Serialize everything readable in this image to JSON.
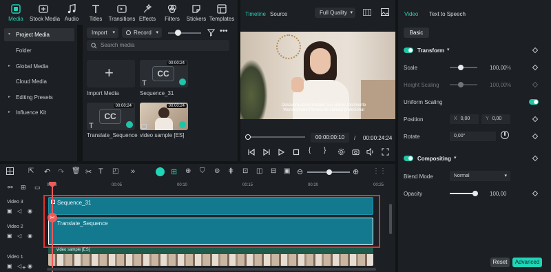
{
  "toolbar": {
    "tabs": [
      {
        "label": "Media",
        "icon": "media-icon",
        "active": true
      },
      {
        "label": "Stock Media",
        "icon": "stock-media-icon"
      },
      {
        "label": "Audio",
        "icon": "music-note-icon"
      },
      {
        "label": "Titles",
        "icon": "text-t-icon"
      },
      {
        "label": "Transitions",
        "icon": "transitions-icon"
      },
      {
        "label": "Effects",
        "icon": "effects-sparkle-icon"
      },
      {
        "label": "Filters",
        "icon": "filters-icon"
      },
      {
        "label": "Stickers",
        "icon": "stickers-icon"
      },
      {
        "label": "Templates",
        "icon": "templates-icon"
      }
    ]
  },
  "sidebar": {
    "items": [
      {
        "label": "Project Media",
        "active": true,
        "expandable": true
      },
      {
        "label": "Folder",
        "active": false,
        "expandable": false
      },
      {
        "label": "Global Media",
        "active": false,
        "expandable": true
      },
      {
        "label": "Cloud Media",
        "active": false,
        "expandable": false
      },
      {
        "label": "Editing Presets",
        "active": false,
        "expandable": true
      },
      {
        "label": "Influence Kit",
        "active": false,
        "expandable": true
      }
    ]
  },
  "media": {
    "import_label": "Import",
    "record_label": "Record",
    "search_placeholder": "Search media",
    "items": [
      {
        "label": "Import Media"
      },
      {
        "label": "Sequence_31",
        "duration": "00:00:24"
      },
      {
        "label": "Translate_Sequence",
        "duration": "00:00:24"
      },
      {
        "label": "video sample [ES]",
        "duration": "00:00:24"
      }
    ]
  },
  "player": {
    "tab_timeline": "Timeline",
    "tab_source": "Source",
    "quality": "Full Quality",
    "current_time": "00:00:00:10",
    "separator": "/",
    "total_time": "00:00:24:24",
    "subtitle_line1": "Descubra cómo traducir sus videos fácilmente",
    "subtitle_line2": "Wondershare Filmora de calidad profesional"
  },
  "inspector": {
    "tab_video": "Video",
    "tab_tts": "Text to Speech",
    "subtab_basic": "Basic",
    "transform_label": "Transform",
    "scale_label": "Scale",
    "scale_value": "100,00",
    "scale_unit": "%",
    "height_scaling_label": "Height Scaling",
    "height_scaling_value": "100,00",
    "height_scaling_unit": "%",
    "uniform_scaling_label": "Uniform Scaling",
    "position_label": "Position",
    "pos_x_label": "X",
    "pos_x_value": "0,00",
    "pos_y_label": "Y",
    "pos_y_value": "0,00",
    "rotate_label": "Rotate",
    "rotate_value": "0,00°",
    "compositing_label": "Compositing",
    "blend_mode_label": "Blend Mode",
    "blend_mode_value": "Normal",
    "opacity_label": "Opacity",
    "opacity_value": "100,00",
    "reset_label": "Reset",
    "advanced_label": "Advanced"
  },
  "timeline": {
    "ruler": [
      "00:00",
      "00:05",
      "00:10",
      "00:15",
      "00:20",
      "00:25"
    ],
    "tracks": [
      {
        "label": "Video 3",
        "clip": "Sequence_31"
      },
      {
        "label": "Video 2",
        "clip": "Translate_Sequence"
      },
      {
        "label": "Video 1",
        "clip": "video sample [ES]"
      }
    ]
  },
  "colors": {
    "accent": "#20d5b8",
    "clip": "#12798e",
    "highlight_border": "#e0322e",
    "playhead": "#f05a5a"
  }
}
